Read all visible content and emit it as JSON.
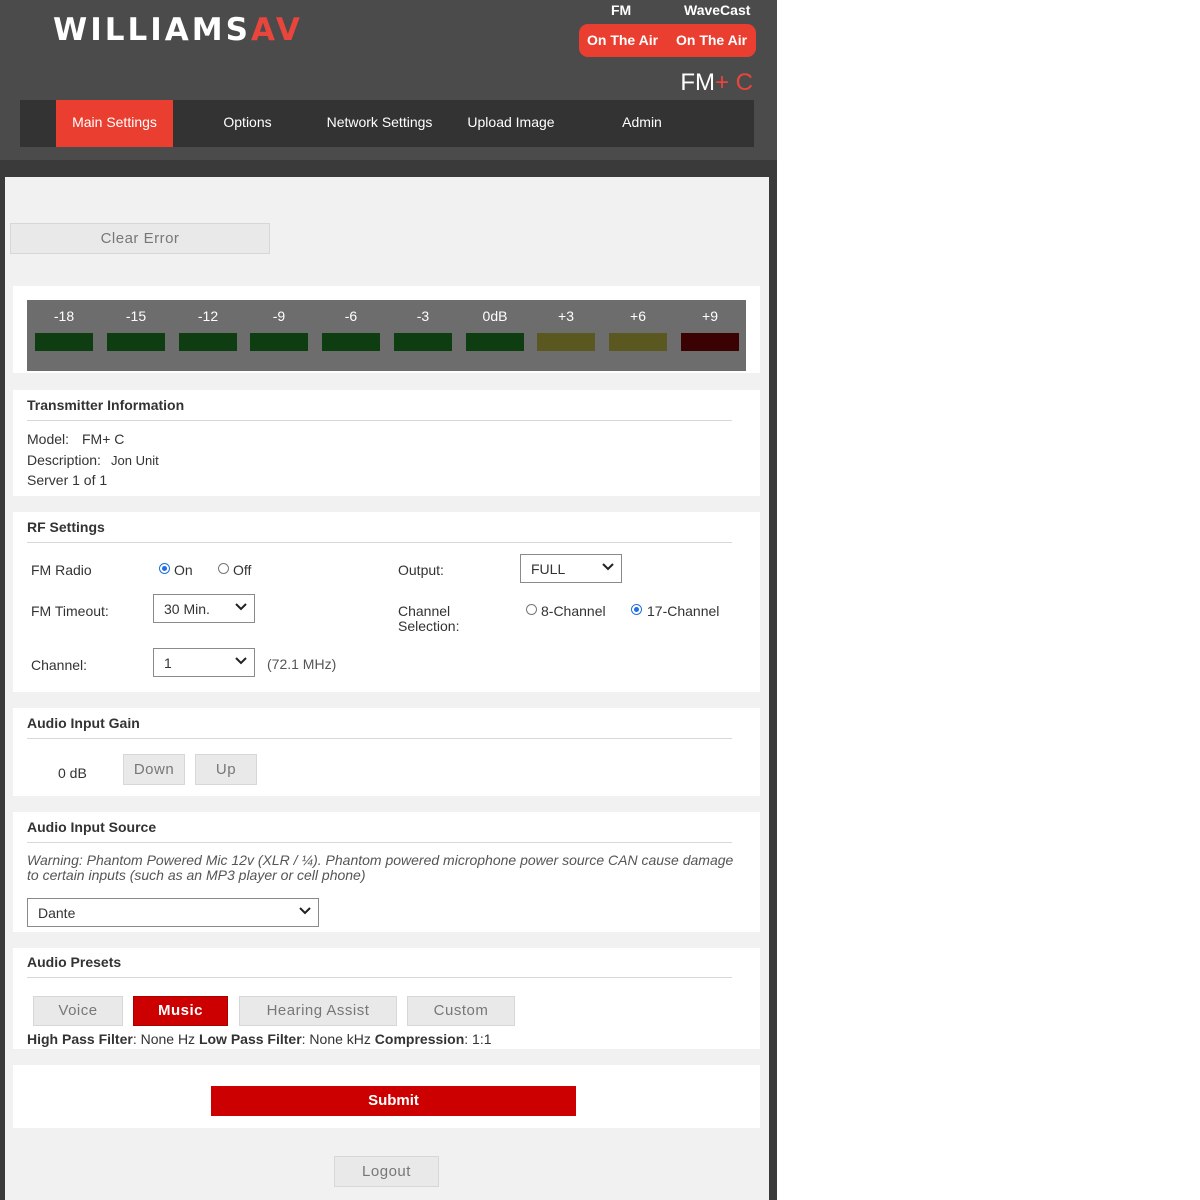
{
  "header": {
    "brand_main": "WILLIAMS",
    "brand_accent": "AV",
    "status": [
      {
        "label": "FM",
        "value": "On The Air"
      },
      {
        "label": "WaveCast",
        "value": "On The Air"
      }
    ],
    "model_main": "FM",
    "model_accent": "+ C"
  },
  "nav": {
    "items": [
      {
        "label": "Main Settings",
        "active": true
      },
      {
        "label": "Options",
        "active": false
      },
      {
        "label": "Network Settings",
        "active": false
      },
      {
        "label": "Upload Image",
        "active": false
      },
      {
        "label": "Admin",
        "active": false
      }
    ]
  },
  "clear_error_label": "Clear Error",
  "vu_meter": {
    "labels": [
      "-18",
      "-15",
      "-12",
      "-9",
      "-6",
      "-3",
      "0dB",
      "+3",
      "+6",
      "+9"
    ],
    "segment_colors": [
      "#0f3d12",
      "#0f3d12",
      "#0f3d12",
      "#0f3d12",
      "#0f3d12",
      "#0f3d12",
      "#0f3d12",
      "#5a5720",
      "#5a5720",
      "#3a0202"
    ]
  },
  "transmitter": {
    "title": "Transmitter Information",
    "model_label": "Model:",
    "model_value": "FM+ C",
    "description_label": "Description:",
    "description_value": "Jon Unit",
    "server_text": "Server 1 of 1"
  },
  "rf": {
    "title": "RF Settings",
    "fm_radio_label": "FM Radio",
    "fm_radio_on": "On",
    "fm_radio_off": "Off",
    "fm_radio_value": "On",
    "fm_timeout_label": "FM Timeout:",
    "fm_timeout_value": "30 Min.",
    "channel_label": "Channel:",
    "channel_value": "1",
    "channel_freq": "(72.1 MHz)",
    "output_label": "Output:",
    "output_value": "FULL",
    "channel_selection_label_1": "Channel",
    "channel_selection_label_2": "Selection:",
    "channel_8": "8-Channel",
    "channel_17": "17-Channel",
    "channel_selection_value": "17-Channel"
  },
  "gain": {
    "title": "Audio Input Gain",
    "value": "0 dB",
    "down_label": "Down",
    "up_label": "Up"
  },
  "source": {
    "title": "Audio Input Source",
    "warning_line1": "Warning: Phantom Powered Mic 12v (XLR / ¼). Phantom powered microphone power source CAN cause damage",
    "warning_line2": "to certain inputs (such as an MP3 player or cell phone)",
    "value": "Dante"
  },
  "presets": {
    "title": "Audio Presets",
    "items": [
      {
        "label": "Voice",
        "active": false
      },
      {
        "label": "Music",
        "active": true
      },
      {
        "label": "Hearing Assist",
        "active": false
      },
      {
        "label": "Custom",
        "active": false
      }
    ],
    "hpf_label": "High Pass Filter",
    "hpf_value": ": None Hz",
    "lpf_label": "Low Pass Filter",
    "lpf_value": ": None kHz",
    "comp_label": "Compression",
    "comp_value": ": 1:1"
  },
  "submit_label": "Submit",
  "logout_label": "Logout"
}
